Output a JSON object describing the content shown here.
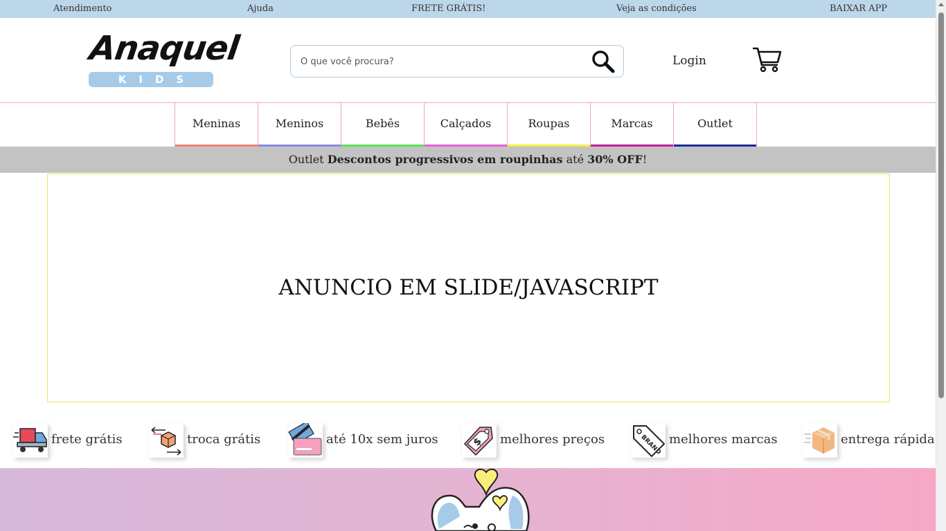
{
  "topbar": {
    "atendimento": "Atendimento",
    "ajuda": "Ajuda",
    "frete": "FRETE GRÁTIS!",
    "condicoes": "Veja as condições",
    "app": "BAIXAR APP"
  },
  "logo": {
    "script": "Anaquel",
    "kids": "KIDS"
  },
  "search": {
    "placeholder": "O que você procura?"
  },
  "header": {
    "login": "Login"
  },
  "nav": [
    {
      "label": "Meninas",
      "color": "#f08070"
    },
    {
      "label": "Meninos",
      "color": "#8888dd"
    },
    {
      "label": "Bebês",
      "color": "#55e855"
    },
    {
      "label": "Calçados",
      "color": "#e85fd8"
    },
    {
      "label": "Roupas",
      "color": "#eeee44"
    },
    {
      "label": "Marcas",
      "color": "#c020a0"
    },
    {
      "label": "Outlet",
      "color": "#1a2aa0"
    }
  ],
  "promo": {
    "prefix": "Outlet",
    "bold1": "Descontos progressivos em roupinhas",
    "middle": "até",
    "bold2": "30% OFF",
    "suffix": "!"
  },
  "slide": {
    "text": "ANUNCIO EM SLIDE/JAVASCRIPT"
  },
  "features": [
    {
      "label": "frete grátis",
      "icon": "delivery-truck-icon"
    },
    {
      "label": "troca grátis",
      "icon": "exchange-box-icon"
    },
    {
      "label": "até 10x sem juros",
      "icon": "credit-card-icon"
    },
    {
      "label": "melhores preços",
      "icon": "price-tag-icon"
    },
    {
      "label": "melhores marcas",
      "icon": "brand-tag-icon"
    },
    {
      "label": "entrega rápida",
      "icon": "fast-box-icon"
    }
  ],
  "colors": {
    "topbar": "#bcd6ea",
    "promo": "#c3c3c3",
    "slide_border": "#f2e35a",
    "banner_start": "#d6b8da",
    "banner_end": "#f6a8c6"
  }
}
